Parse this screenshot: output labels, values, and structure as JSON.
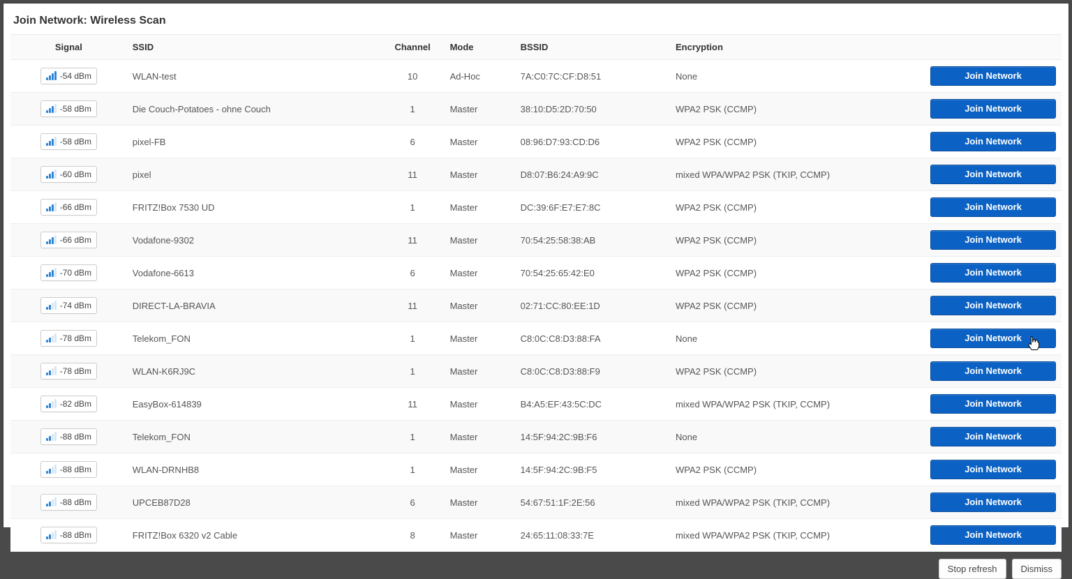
{
  "title": "Join Network: Wireless Scan",
  "headers": {
    "signal": "Signal",
    "ssid": "SSID",
    "channel": "Channel",
    "mode": "Mode",
    "bssid": "BSSID",
    "encryption": "Encryption"
  },
  "join_label": "Join Network",
  "footer": {
    "stop_refresh": "Stop refresh",
    "dismiss": "Dismiss"
  },
  "networks": [
    {
      "signal": "-54 dBm",
      "bars": 4,
      "ssid": "WLAN-test",
      "channel": "10",
      "mode": "Ad-Hoc",
      "bssid": "7A:C0:7C:CF:D8:51",
      "encryption": "None"
    },
    {
      "signal": "-58 dBm",
      "bars": 3,
      "ssid": "Die Couch-Potatoes - ohne Couch",
      "channel": "1",
      "mode": "Master",
      "bssid": "38:10:D5:2D:70:50",
      "encryption": "WPA2 PSK (CCMP)"
    },
    {
      "signal": "-58 dBm",
      "bars": 3,
      "ssid": "pixel-FB",
      "channel": "6",
      "mode": "Master",
      "bssid": "08:96:D7:93:CD:D6",
      "encryption": "WPA2 PSK (CCMP)"
    },
    {
      "signal": "-60 dBm",
      "bars": 3,
      "ssid": "pixel",
      "channel": "11",
      "mode": "Master",
      "bssid": "D8:07:B6:24:A9:9C",
      "encryption": "mixed WPA/WPA2 PSK (TKIP, CCMP)"
    },
    {
      "signal": "-66 dBm",
      "bars": 3,
      "ssid": "FRITZ!Box 7530 UD",
      "channel": "1",
      "mode": "Master",
      "bssid": "DC:39:6F:E7:E7:8C",
      "encryption": "WPA2 PSK (CCMP)"
    },
    {
      "signal": "-66 dBm",
      "bars": 3,
      "ssid": "Vodafone-9302",
      "channel": "11",
      "mode": "Master",
      "bssid": "70:54:25:58:38:AB",
      "encryption": "WPA2 PSK (CCMP)"
    },
    {
      "signal": "-70 dBm",
      "bars": 3,
      "ssid": "Vodafone-6613",
      "channel": "6",
      "mode": "Master",
      "bssid": "70:54:25:65:42:E0",
      "encryption": "WPA2 PSK (CCMP)"
    },
    {
      "signal": "-74 dBm",
      "bars": 2,
      "ssid": "DIRECT-LA-BRAVIA",
      "channel": "11",
      "mode": "Master",
      "bssid": "02:71:CC:80:EE:1D",
      "encryption": "WPA2 PSK (CCMP)"
    },
    {
      "signal": "-78 dBm",
      "bars": 2,
      "ssid": "Telekom_FON",
      "channel": "1",
      "mode": "Master",
      "bssid": "C8:0C:C8:D3:88:FA",
      "encryption": "None"
    },
    {
      "signal": "-78 dBm",
      "bars": 2,
      "ssid": "WLAN-K6RJ9C",
      "channel": "1",
      "mode": "Master",
      "bssid": "C8:0C:C8:D3:88:F9",
      "encryption": "WPA2 PSK (CCMP)"
    },
    {
      "signal": "-82 dBm",
      "bars": 2,
      "ssid": "EasyBox-614839",
      "channel": "11",
      "mode": "Master",
      "bssid": "B4:A5:EF:43:5C:DC",
      "encryption": "mixed WPA/WPA2 PSK (TKIP, CCMP)"
    },
    {
      "signal": "-88 dBm",
      "bars": 2,
      "ssid": "Telekom_FON",
      "channel": "1",
      "mode": "Master",
      "bssid": "14:5F:94:2C:9B:F6",
      "encryption": "None"
    },
    {
      "signal": "-88 dBm",
      "bars": 2,
      "ssid": "WLAN-DRNHB8",
      "channel": "1",
      "mode": "Master",
      "bssid": "14:5F:94:2C:9B:F5",
      "encryption": "WPA2 PSK (CCMP)"
    },
    {
      "signal": "-88 dBm",
      "bars": 2,
      "ssid": "UPCEB87D28",
      "channel": "6",
      "mode": "Master",
      "bssid": "54:67:51:1F:2E:56",
      "encryption": "mixed WPA/WPA2 PSK (TKIP, CCMP)"
    },
    {
      "signal": "-88 dBm",
      "bars": 2,
      "ssid": "FRITZ!Box 6320 v2 Cable",
      "channel": "8",
      "mode": "Master",
      "bssid": "24:65:11:08:33:7E",
      "encryption": "mixed WPA/WPA2 PSK (TKIP, CCMP)"
    }
  ]
}
